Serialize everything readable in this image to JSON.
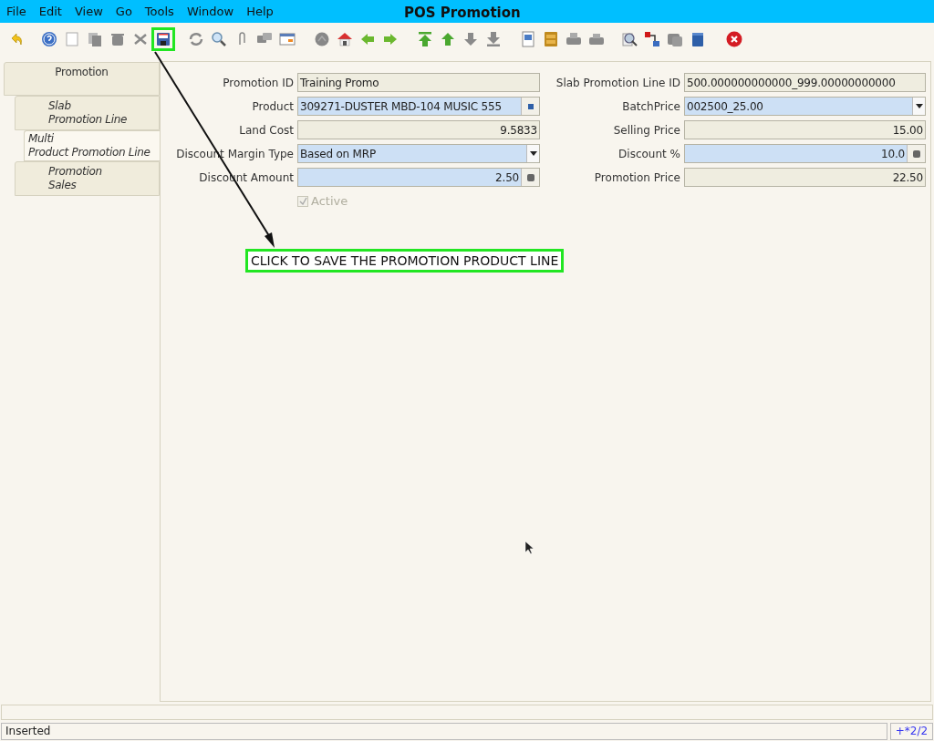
{
  "menu": [
    "File",
    "Edit",
    "View",
    "Go",
    "Tools",
    "Window",
    "Help"
  ],
  "window": {
    "title": "POS Promotion"
  },
  "tabs": [
    {
      "label": [
        "Promotion"
      ],
      "selected": false,
      "children": [
        {
          "label": [
            "Slab",
            "Promotion Line"
          ],
          "selected": false
        },
        {
          "label": [
            "Multi",
            "Product Promotion Line"
          ],
          "selected": true
        },
        {
          "label": [
            "Promotion",
            "Sales"
          ],
          "selected": false
        }
      ]
    }
  ],
  "fields_left": [
    {
      "label": "Promotion ID",
      "value": "Training Promo",
      "kind": "text",
      "editable": false
    },
    {
      "label": "Product",
      "value": "309271-DUSTER MBD-104 MUSIC 555",
      "kind": "lookup",
      "editable": true
    },
    {
      "label": "Land Cost",
      "value": "9.5833",
      "kind": "number",
      "editable": false
    },
    {
      "label": "Discount Margin Type",
      "value": "Based on MRP",
      "kind": "list",
      "editable": true
    },
    {
      "label": "Discount Amount",
      "value": "2.50",
      "kind": "calc",
      "editable": true
    }
  ],
  "fields_right": [
    {
      "label": "Slab Promotion Line ID",
      "value": "500.000000000000_999.00000000000",
      "kind": "text",
      "editable": false
    },
    {
      "label": "BatchPrice",
      "value": "002500_25.00",
      "kind": "list",
      "editable": true
    },
    {
      "label": "Selling Price",
      "value": "15.00",
      "kind": "number",
      "editable": false
    },
    {
      "label": "Discount %",
      "value": "10.0",
      "kind": "calc",
      "editable": true
    },
    {
      "label": "Promotion Price",
      "value": "22.50",
      "kind": "number",
      "editable": false
    }
  ],
  "active": {
    "label": "Active",
    "checked": true,
    "disabled": true
  },
  "callout": "CLICK TO SAVE THE PROMOTION PRODUCT LINE",
  "status_bar": {
    "message": "Inserted",
    "record": "+*2/2"
  }
}
